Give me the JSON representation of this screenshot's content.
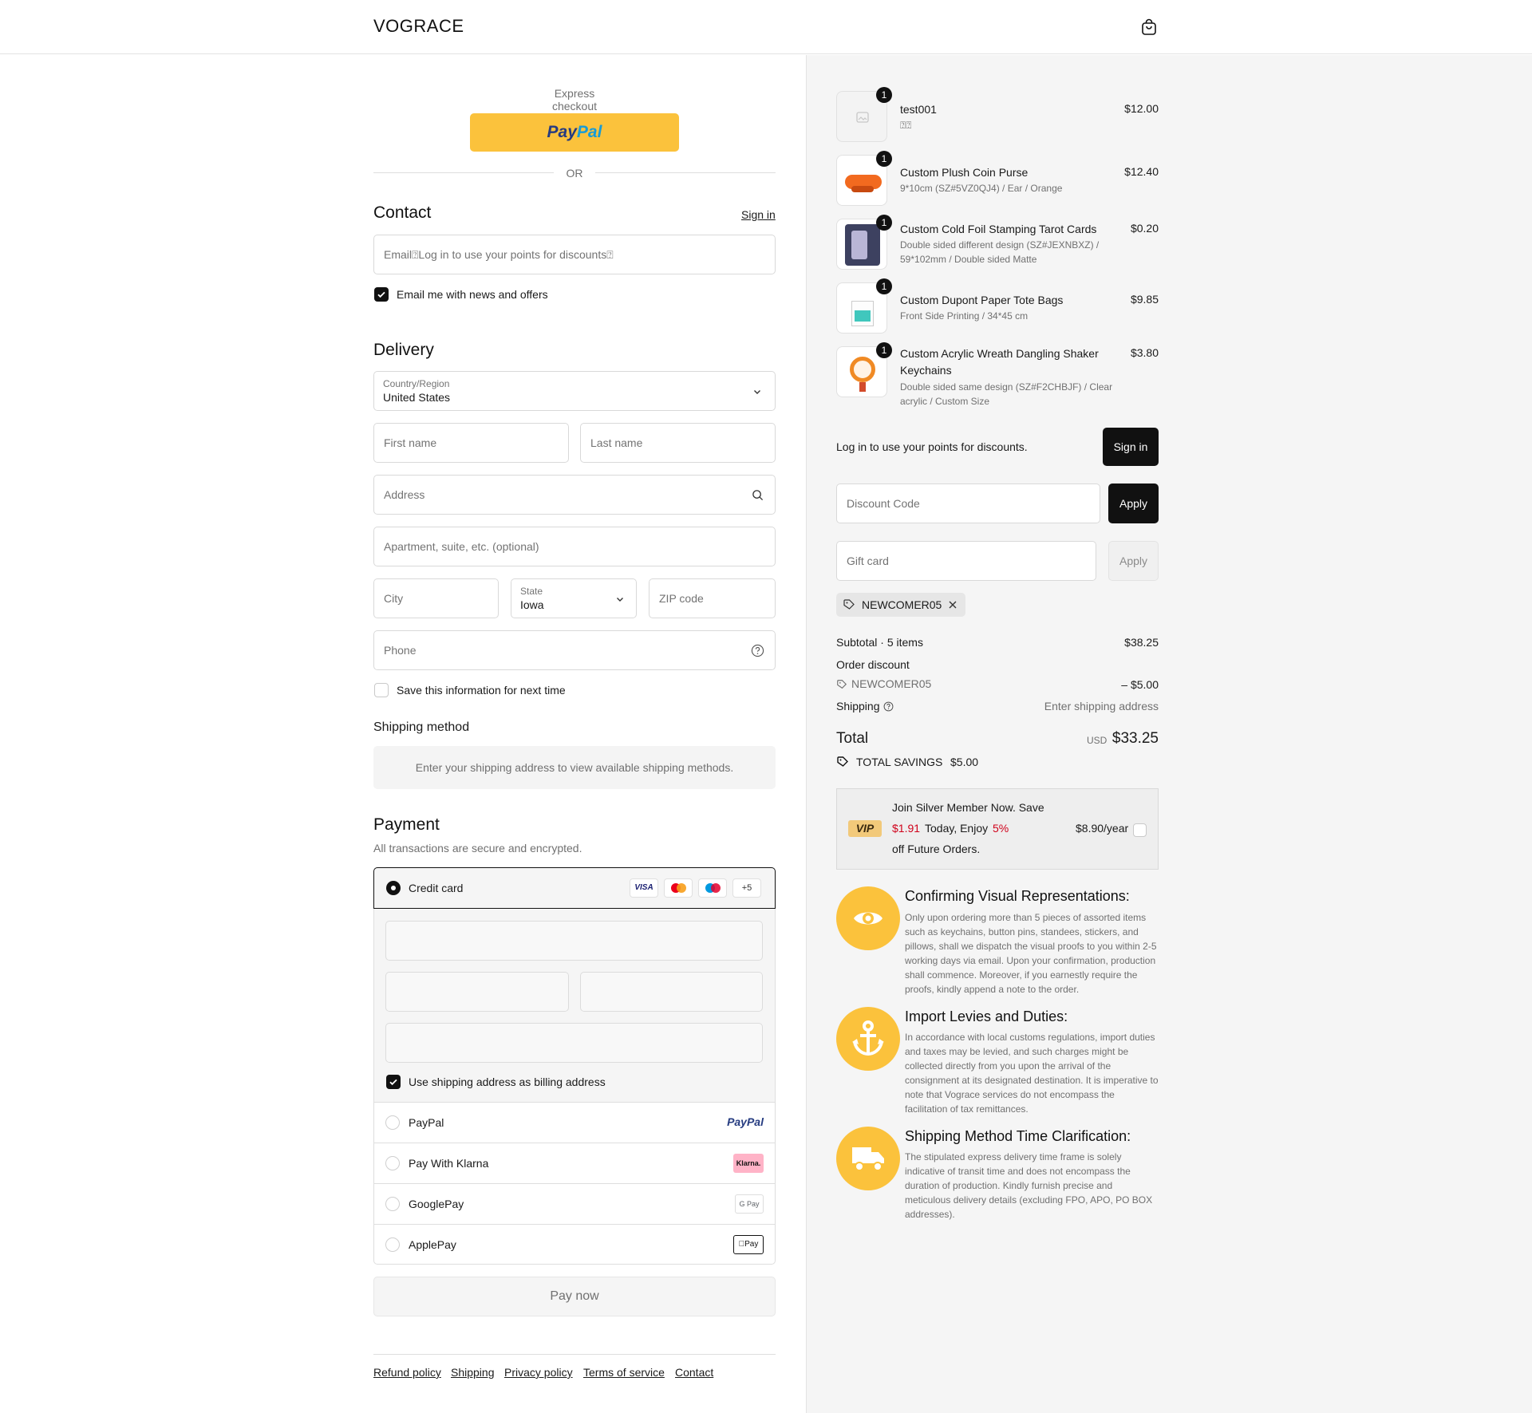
{
  "header": {
    "logo": "VOGRACE",
    "cart_icon": "shopping-bag-icon"
  },
  "express": {
    "label": "Express checkout",
    "paypal_a": "Pay",
    "paypal_b": "Pal",
    "or": "OR"
  },
  "contact": {
    "title": "Contact",
    "sign_in": "Sign in",
    "email_placeholder": "Email⍰Log in to use your points for discounts⍰",
    "newsletter_label": "Email me with news and offers"
  },
  "delivery": {
    "title": "Delivery",
    "country_label": "Country/Region",
    "country_value": "United States",
    "first_name": "First name",
    "last_name": "Last name",
    "address": "Address",
    "apartment": "Apartment, suite, etc. (optional)",
    "city": "City",
    "state_label": "State",
    "state_value": "Iowa",
    "zip": "ZIP code",
    "phone": "Phone",
    "save_info": "Save this information for next time"
  },
  "shipping_method": {
    "title": "Shipping method",
    "notice": "Enter your shipping address to view available shipping methods."
  },
  "payment": {
    "title": "Payment",
    "subtitle": "All transactions are secure and encrypted.",
    "credit_card": "Credit card",
    "visa": "VISA",
    "more_cards": "+5",
    "billing_same": "Use shipping address as billing address",
    "methods": [
      {
        "name": "PayPal",
        "logo": "PayPal"
      },
      {
        "name": "Pay With Klarna",
        "logo": "Klarna."
      },
      {
        "name": "GooglePay",
        "logo": "G Pay"
      },
      {
        "name": "ApplePay",
        "logo": "Pay"
      }
    ],
    "pay_now": "Pay now"
  },
  "footer": {
    "links": [
      "Refund policy",
      "Shipping",
      "Privacy policy",
      "Terms of service",
      "Contact"
    ]
  },
  "order": {
    "items": [
      {
        "qty": "1",
        "name": "test001",
        "variant": "⍰⍰",
        "price": "$12.00"
      },
      {
        "qty": "1",
        "name": "Custom Plush Coin Purse",
        "variant": "9*10cm (SZ#5VZ0QJ4) / Ear / Orange",
        "price": "$12.40"
      },
      {
        "qty": "1",
        "name": "Custom Cold Foil Stamping Tarot Cards",
        "variant": "Double sided different design (SZ#JEXNBXZ) / 59*102mm / Double sided Matte",
        "price": "$0.20"
      },
      {
        "qty": "1",
        "name": "Custom Dupont Paper Tote Bags",
        "variant": "Front Side Printing / 34*45 cm",
        "price": "$9.85"
      },
      {
        "qty": "1",
        "name": "Custom Acrylic Wreath Dangling Shaker Keychains",
        "variant": "Double sided same design (SZ#F2CHBJF) / Clear acrylic / Custom Size",
        "price": "$3.80"
      }
    ],
    "points_text": "Log in to use your points for discounts.",
    "sign_in": "Sign in",
    "discount_placeholder": "Discount Code",
    "apply": "Apply",
    "gift_placeholder": "Gift card",
    "gift_apply": "Apply",
    "applied_code": "NEWCOMER05",
    "subtotal_label": "Subtotal · 5 items",
    "subtotal_value": "$38.25",
    "order_discount_label": "Order discount",
    "discount_code": "NEWCOMER05",
    "discount_value": "– $5.00",
    "shipping_label": "Shipping",
    "shipping_value": "Enter shipping address",
    "total_label": "Total",
    "currency": "USD",
    "total_value": "$33.25",
    "savings_label": "TOTAL SAVINGS",
    "savings_value": "$5.00"
  },
  "vip": {
    "badge": "VIP",
    "line1": "Join Silver Member Now. Save",
    "amount": "$1.91",
    "today": "Today, Enjoy",
    "percent": "5%",
    "line3": "off Future Orders.",
    "price": "$8.90/year"
  },
  "info": [
    {
      "icon": "eye-icon",
      "title": "Confirming Visual Representations:",
      "text": "Only upon ordering more than 5 pieces of assorted items such as keychains, button pins, standees, stickers, and pillows, shall we dispatch the visual proofs to you within 2-5 working days via email. Upon your confirmation, production shall commence. Moreover, if you earnestly require the proofs, kindly append a note to the order."
    },
    {
      "icon": "anchor-icon",
      "title": "Import Levies and Duties:",
      "text": "In accordance with local customs regulations, import duties and taxes may be levied, and such charges might be collected directly from you upon the arrival of the consignment at its designated destination. It is imperative to note that Vograce services do not encompass the facilitation of tax remittances."
    },
    {
      "icon": "truck-icon",
      "title": "Shipping Method Time Clarification:",
      "text": "The stipulated express delivery time frame is solely indicative of transit time and does not encompass the duration of production. Kindly furnish precise and meticulous delivery details (excluding FPO, APO, PO BOX addresses)."
    }
  ]
}
